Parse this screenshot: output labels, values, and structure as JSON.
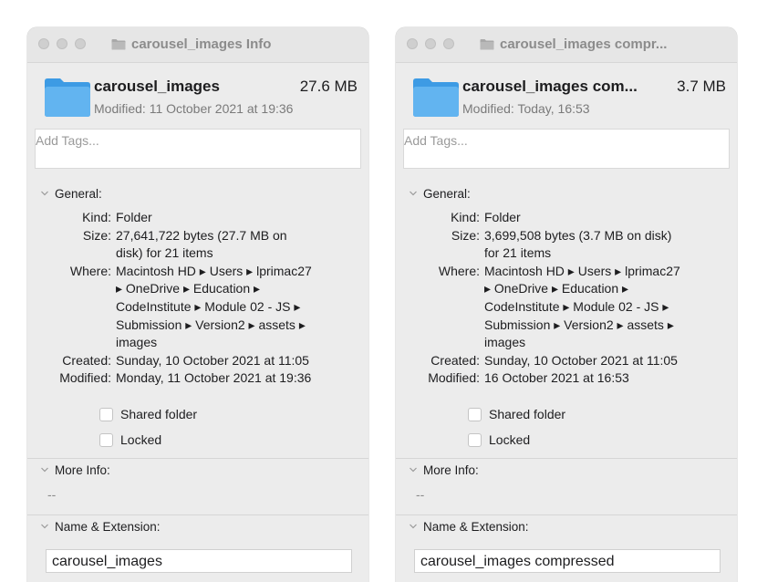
{
  "colors": {
    "folder_blue": "#62b4f0",
    "window_bg": "#ececec"
  },
  "windows": [
    {
      "title": "carousel_images Info",
      "name": "carousel_images",
      "size": "27.6 MB",
      "modified_summary": "Modified: 11 October 2021 at 19:36",
      "tags_placeholder": "Add Tags...",
      "general_label": "General:",
      "kind_label": "Kind:",
      "kind": "Folder",
      "size_label": "Size:",
      "size_lines": [
        "27,641,722 bytes (27.7 MB on",
        "disk) for 21 items"
      ],
      "where_label": "Where:",
      "where_lines": [
        "Macintosh HD ▸ Users ▸ lprimac27",
        "▸ OneDrive ▸ Education ▸",
        "CodeInstitute ▸ Module 02 - JS ▸",
        "Submission ▸ Version2 ▸ assets ▸",
        "images"
      ],
      "created_label": "Created:",
      "created": "Sunday, 10 October 2021 at 11:05",
      "modified_label": "Modified:",
      "modified": "Monday, 11 October 2021 at 19:36",
      "shared_label": "Shared folder",
      "locked_label": "Locked",
      "more_info_label": "More Info:",
      "more_info_value": "--",
      "name_ext_label": "Name & Extension:",
      "name_field": "carousel_images"
    },
    {
      "title": "carousel_images compr...",
      "name": "carousel_images com...",
      "size": "3.7 MB",
      "modified_summary": "Modified: Today, 16:53",
      "tags_placeholder": "Add Tags...",
      "general_label": "General:",
      "kind_label": "Kind:",
      "kind": "Folder",
      "size_label": "Size:",
      "size_lines": [
        "3,699,508 bytes (3.7 MB on disk)",
        "for 21 items"
      ],
      "where_label": "Where:",
      "where_lines": [
        "Macintosh HD ▸ Users ▸ lprimac27",
        "▸ OneDrive ▸ Education ▸",
        "CodeInstitute ▸ Module 02 - JS ▸",
        "Submission ▸ Version2 ▸ assets ▸",
        "images"
      ],
      "created_label": "Created:",
      "created": "Sunday, 10 October 2021 at 11:05",
      "modified_label": "Modified:",
      "modified": "16 October 2021 at 16:53",
      "shared_label": "Shared folder",
      "locked_label": "Locked",
      "more_info_label": "More Info:",
      "more_info_value": "--",
      "name_ext_label": "Name & Extension:",
      "name_field": "carousel_images compressed"
    }
  ]
}
